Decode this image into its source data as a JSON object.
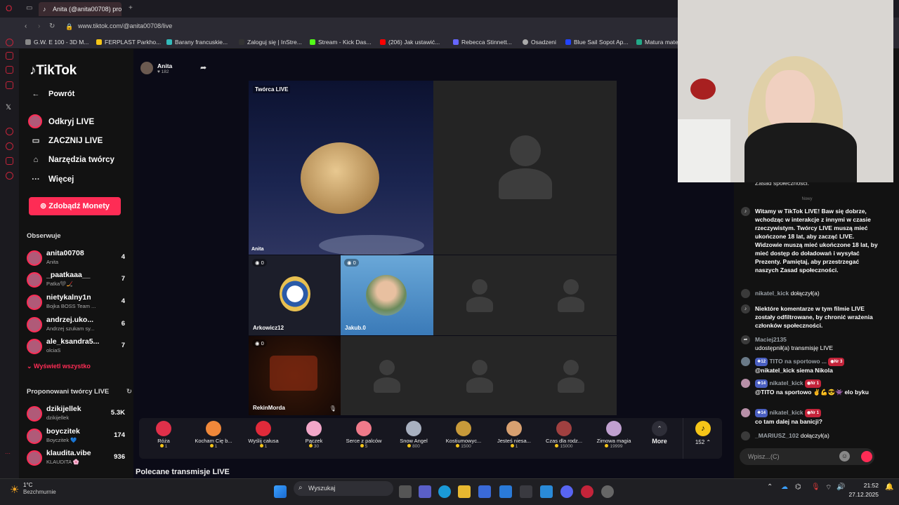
{
  "browser": {
    "tab_title": "Anita (@anita00708) pro",
    "url": "www.tiktok.com/@anita00708/live",
    "bookmarks": [
      "G.W. E 100 - 3D M...",
      "FERPLAST Parkho...",
      "Barany francuskie...",
      "Zaloguj się | InStre...",
      "Stream - Kick Das...",
      "(206) Jak ustawić...",
      "Rebecca Stinnett...",
      "Osadzeni",
      "Blue Sail Sopot Ap...",
      "Matura mate"
    ]
  },
  "sidebar": {
    "logo": "TikTok",
    "back": "Powrót",
    "discover": "Odkryj LIVE",
    "go_live": "ZACZNIJ LIVE",
    "creator_tools": "Narzędzia twórcy",
    "more": "Więcej",
    "get_coins": "Zdobądź Monety",
    "following_title": "Obserwuje",
    "following": [
      {
        "name": "anita00708",
        "sub": "Anita",
        "count": "4"
      },
      {
        "name": "_paatkaaa__",
        "sub": "Patka🖤🏒",
        "count": "7"
      },
      {
        "name": "nietykalny1n",
        "sub": "Bojka BOSS Team ...",
        "count": "4"
      },
      {
        "name": "andrzej.uko...",
        "sub": "Andrzej szukam sy...",
        "count": "6"
      },
      {
        "name": "ale_ksandra5...",
        "sub": "olciaS",
        "count": "7"
      }
    ],
    "show_all": "Wyświetl wszystko",
    "suggested_title": "Proponowani twórcy LIVE",
    "suggested": [
      {
        "name": "dzikijellek",
        "sub": "dzikijellek",
        "count": "5.3K"
      },
      {
        "name": "boyczitek",
        "sub": "Boyczitek 💙",
        "count": "174"
      },
      {
        "name": "klaudita.vibe",
        "sub": "KLAUDITA 🌸",
        "count": "936"
      }
    ]
  },
  "stream": {
    "host_name": "Anita",
    "host_likes": "182",
    "creator_label": "Twórca LIVE",
    "creator_name": "Anita",
    "guests": [
      {
        "name": "Arkowicz12",
        "count": "0"
      },
      {
        "name": "Jakub.0",
        "count": "0"
      },
      {
        "name": "RekinMorda",
        "count": "0"
      }
    ]
  },
  "gifts": [
    {
      "name": "Róża",
      "price": "1",
      "color": "#e0304a"
    },
    {
      "name": "Kocham Cię b...",
      "price": "1",
      "color": "#f0883a"
    },
    {
      "name": "Wyślij całusa",
      "price": "1",
      "color": "#e02a3a"
    },
    {
      "name": "Pączek",
      "price": "30",
      "color": "#f2a6c8"
    },
    {
      "name": "Serce z palców",
      "price": "5",
      "color": "#f07a8a"
    },
    {
      "name": "Snow Angel",
      "price": "800",
      "color": "#a8b0c0"
    },
    {
      "name": "Kostiumowyc...",
      "price": "1500",
      "color": "#c89a3a"
    },
    {
      "name": "Jesteś niesa...",
      "price": "1",
      "color": "#d8a070"
    },
    {
      "name": "Czas dla rodz...",
      "price": "15000",
      "color": "#a04040"
    },
    {
      "name": "Zimowa magia",
      "price": "19999",
      "color": "#c0a0d0"
    }
  ],
  "gift_more": "More",
  "coin_balance": "152",
  "recommended_title": "Polecane transmisje LIVE",
  "chat": {
    "top_fragment": "Zasad społeczności.",
    "new_label": "Nowy",
    "messages": [
      {
        "icon": "tiktok",
        "text": "Witamy w TikTok LIVE! Baw się dobrze, wchodząc w interakcje z innymi w czasie rzeczywistym. Twórcy LIVE muszą mieć ukończone 18 lat, aby zacząć LIVE. Widzowie muszą mieć ukończone 18 lat, by mieć dostęp do doładowań i wysyłać Prezenty. Pamiętaj, aby przestrzegać naszych Zasad społeczności."
      },
      {
        "user": "nikatel_kick",
        "text": "dołączył(a)"
      },
      {
        "icon": "tiktok",
        "text": "Niektóre komentarze w tym filmie LIVE zostały odfiltrowane, by chronić wrażenia członków społeczności."
      },
      {
        "user": "Maciej2135",
        "text": "udostępnił(a) transmisję LIVE"
      },
      {
        "user": "TITO na sportowo ...",
        "level": "12",
        "rank": "Nr 3",
        "text": "@nikatel_kick siema Nikola"
      },
      {
        "user": "nikatel_kick",
        "level": "14",
        "rank": "Nr 1",
        "text": "@TITO na sportowo ✌️💪😎👾 elo byku"
      },
      {
        "user": "nikatel_kick",
        "level": "14",
        "rank": "Nr 1",
        "text": "co tam dalej na banicji?"
      },
      {
        "user": "_MARIUSZ_102",
        "text": "dołączył(a)"
      }
    ],
    "input_placeholder": "Wpisz...(C)"
  },
  "taskbar": {
    "weather_temp": "1°C",
    "weather_desc": "Bezchmurnie",
    "search_placeholder": "Wyszukaj",
    "time": "21:52",
    "date": "27.12.2025"
  }
}
